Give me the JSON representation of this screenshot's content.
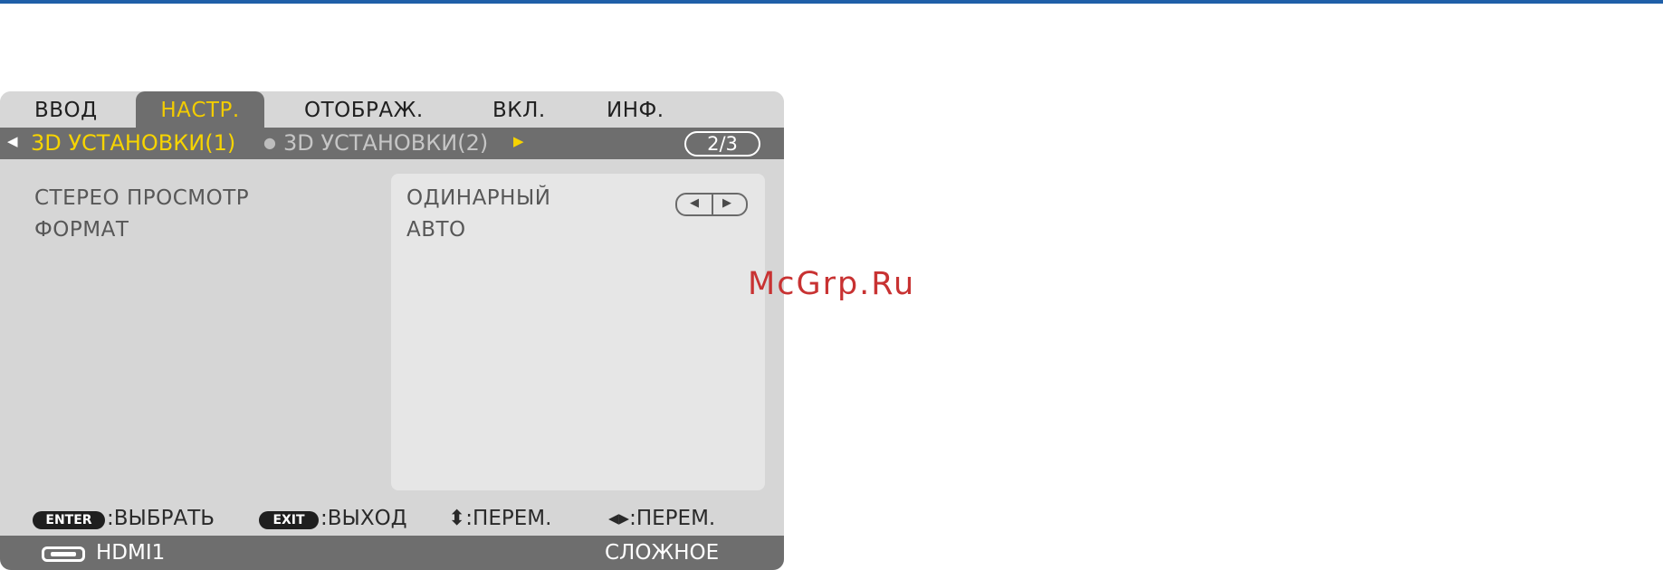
{
  "menu": {
    "tabs": [
      "ВВОД",
      "НАСТР.",
      "ОТОБРАЖ.",
      "ВКЛ.",
      "ИНФ."
    ],
    "active_tab": "НАСТР.",
    "subtabs": {
      "active": "3D УСТАНОВКИ(1)",
      "inactive": "3D УСТАНОВКИ(2)",
      "page_indicator": "2/3"
    },
    "items": [
      {
        "label": "СТЕРЕО ПРОСМОТР",
        "value": "ОДИНАРНЫЙ"
      },
      {
        "label": "ФОРМАТ",
        "value": "АВТО"
      }
    ],
    "help": {
      "enter_key": "ENTER",
      "enter_text": ":ВЫБРАТЬ",
      "exit_key": "EXIT",
      "exit_text": ":ВЫХОД",
      "updown_text": "⬍:ПЕРЕМ.",
      "leftright_text": "◂▸:ПЕРЕМ."
    },
    "status": {
      "source": "HDMI1",
      "mode": "СЛОЖНОЕ"
    }
  },
  "watermark": "McGrp.Ru",
  "colors": {
    "active_tab_text": "#f2cc00",
    "bar_gray": "#6e6e6e",
    "panel_gray": "#d6d6d6",
    "value_panel": "#e6e6e6",
    "watermark": "#c83232"
  }
}
